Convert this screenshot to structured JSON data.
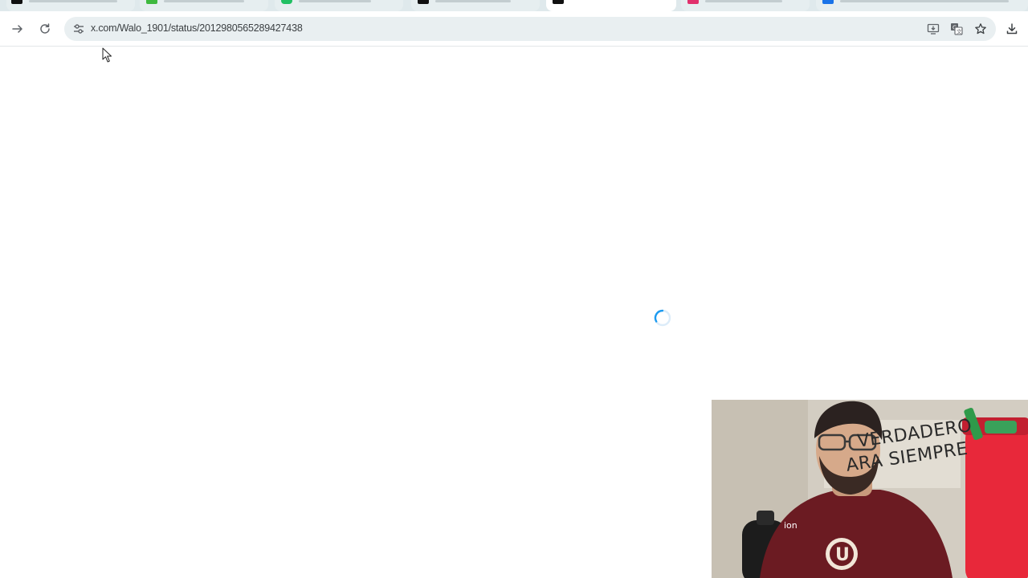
{
  "browser": {
    "url": "x.com/Walo_1901/status/2012980565289427438",
    "active_tab_index": 5,
    "tabs": [
      {
        "favicon": "x-icon",
        "color": "#111111"
      },
      {
        "favicon": "green-square-icon",
        "color": "#3fb93f"
      },
      {
        "favicon": "green-circle-icon",
        "color": "#21c063"
      },
      {
        "favicon": "black-square-icon",
        "color": "#111111"
      },
      {
        "favicon": "x-icon",
        "color": "#111111"
      },
      {
        "favicon": "instagram-icon",
        "color": "#e1306c"
      },
      {
        "favicon": "blue-square-icon",
        "color": "#1a73e8"
      }
    ],
    "toolbar_icons": [
      "forward-icon",
      "reload-icon",
      "site-info-icon",
      "install-app-icon",
      "translate-icon",
      "bookmark-star-icon",
      "download-icon"
    ]
  },
  "page": {
    "state": "loading",
    "spinner_color": "#1d9bf0"
  },
  "webcam": {
    "wall_text_line1": "VERDADERO",
    "wall_text_line2": "ARA SIEMPRE",
    "shirt_text": "ion",
    "shirt_color": "#6b1b22",
    "cup_color": "#e8283a"
  }
}
